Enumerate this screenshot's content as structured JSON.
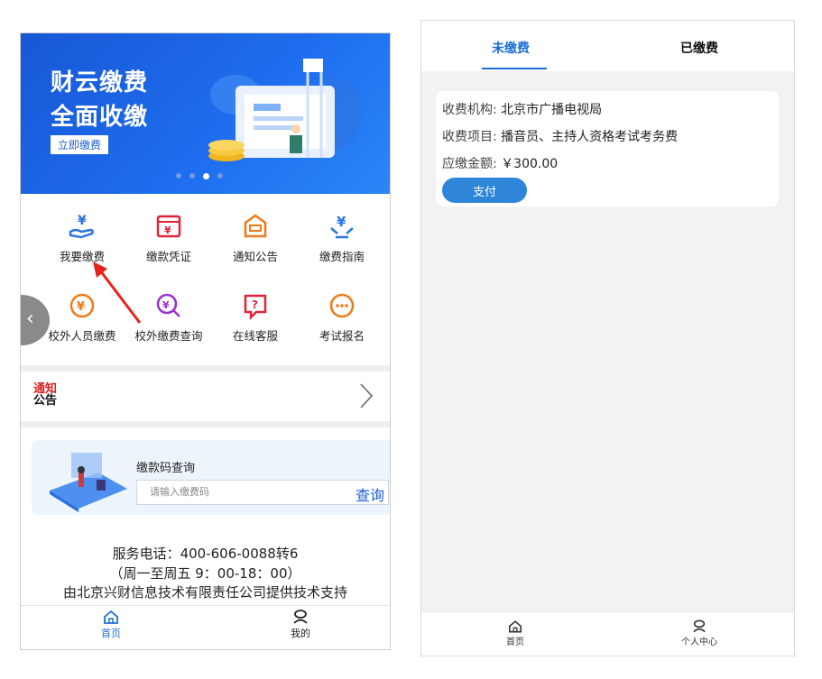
{
  "left": {
    "banner": {
      "title_line1": "财云缴费",
      "title_line2": "全面收缴",
      "button": "立即缴费",
      "carousel_count": 4,
      "carousel_active": 3
    },
    "grid": [
      {
        "label": "我要缴费",
        "icon": "yuan-hand-icon"
      },
      {
        "label": "缴款凭证",
        "icon": "receipt-icon"
      },
      {
        "label": "通知公告",
        "icon": "notice-box-icon"
      },
      {
        "label": "缴费指南",
        "icon": "guide-icon"
      },
      {
        "label": "校外人员缴费",
        "icon": "yuan-circle-icon"
      },
      {
        "label": "校外缴费查询",
        "icon": "yuan-search-icon"
      },
      {
        "label": "在线客服",
        "icon": "question-chat-icon"
      },
      {
        "label": "考试报名",
        "icon": "chat-dots-icon"
      }
    ],
    "notice": {
      "logo_top": "通知",
      "logo_bottom": "公告"
    },
    "query": {
      "title": "缴款码查询",
      "placeholder": "请输入缴费码",
      "button": "查询"
    },
    "footer": {
      "line1": "服务电话：400-606-0088转6",
      "line2": "（周一至周五 9：00-18：00）",
      "line3": "由北京兴财信息技术有限责任公司提供技术支持"
    },
    "tabbar": {
      "home": "首页",
      "mine": "我的"
    }
  },
  "right": {
    "tabs": {
      "unpaid": "未缴费",
      "paid": "已缴费"
    },
    "record": {
      "org_label": "收费机构:",
      "org_value": "北京市广播电视局",
      "item_label": "收费项目:",
      "item_value": "播音员、主持人资格考试考务费",
      "amount_label": "应缴金额:",
      "amount_value": "￥300.00",
      "pay_button": "支付"
    },
    "tabbar": {
      "home": "首页",
      "center": "个人中心"
    }
  },
  "colors": {
    "brand_blue": "#1a6ed8",
    "banner_blue": "#1757d6",
    "icon_red": "#e0233a",
    "icon_orange": "#f07a1a",
    "icon_purple": "#9b2fd0"
  }
}
